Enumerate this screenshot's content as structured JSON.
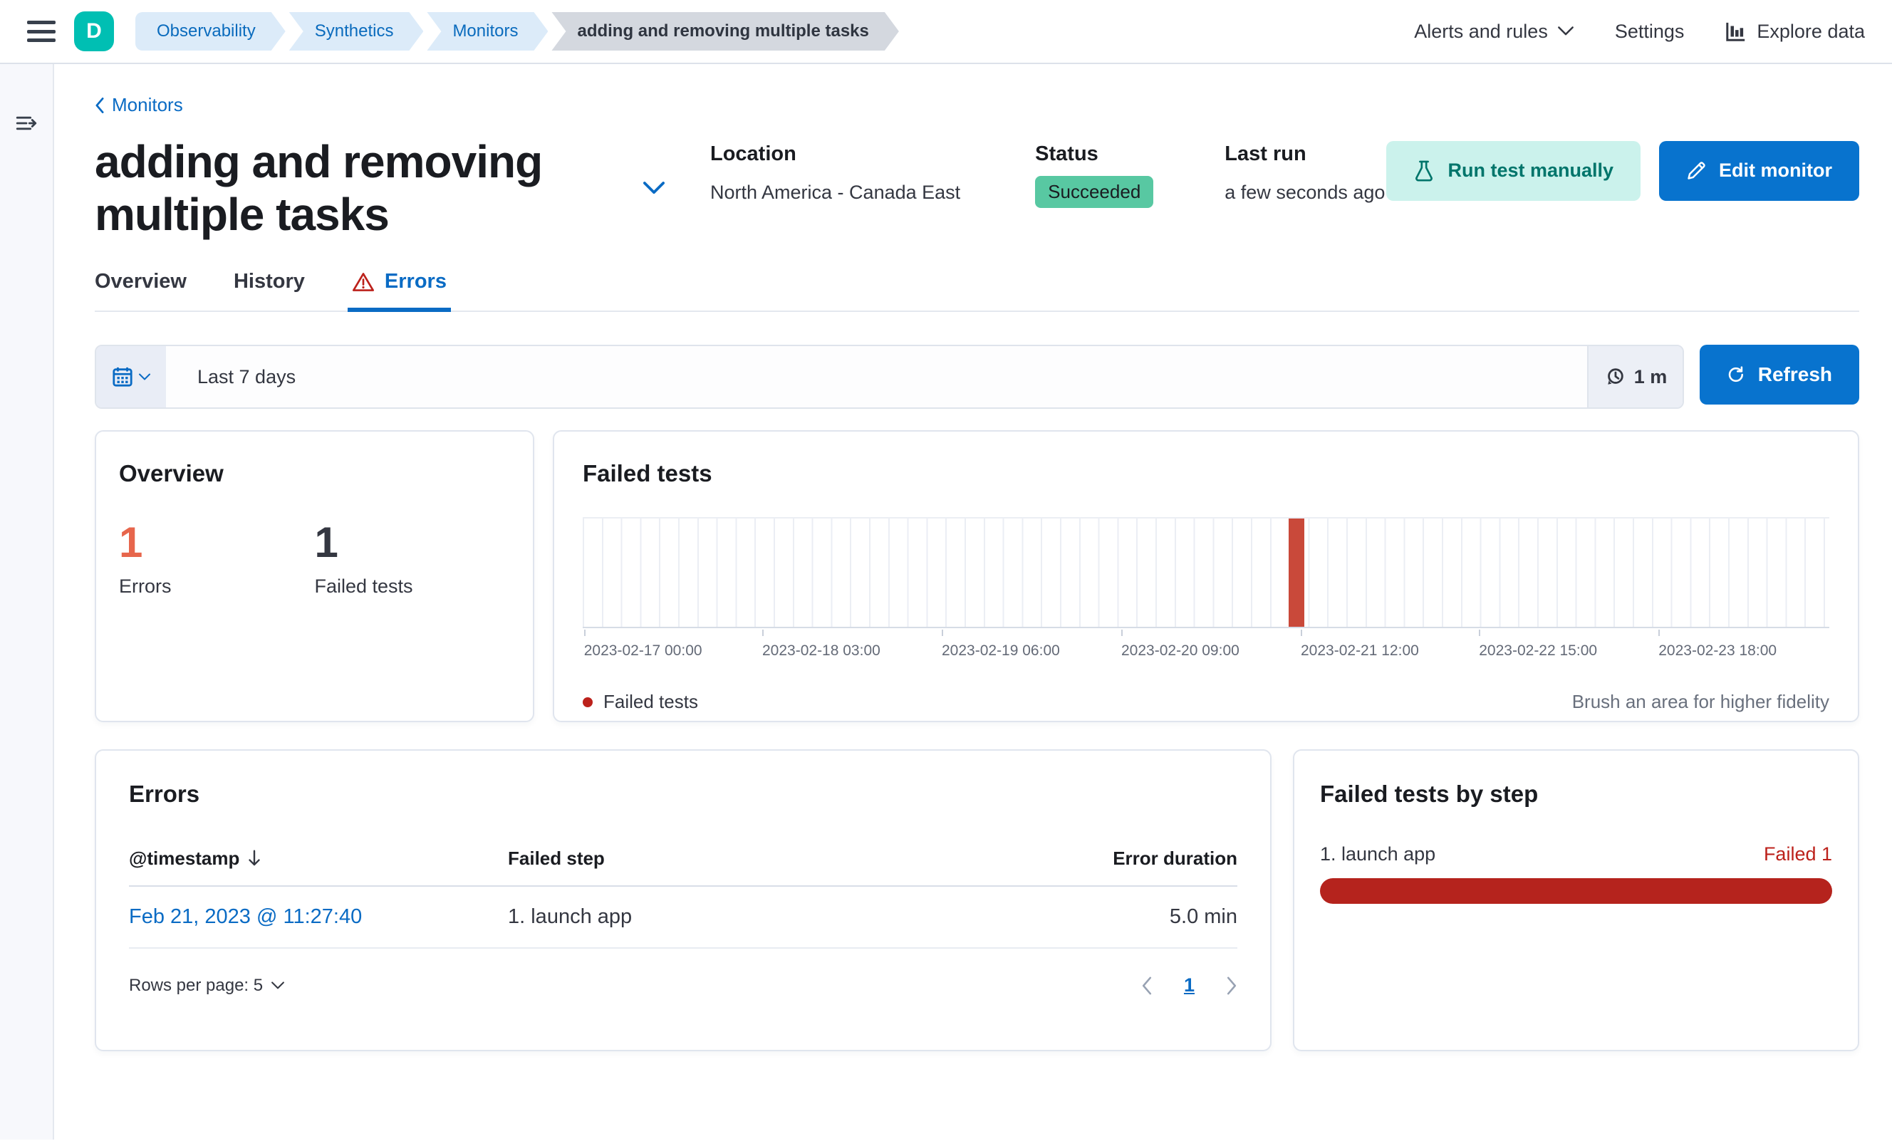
{
  "colors": {
    "primary_blue": "#0873CE",
    "link_blue": "#0A6BC4",
    "teal_badge": "#00BFB3",
    "success_green": "#58C8A2",
    "accent_orange": "#E7664C",
    "danger_red": "#BC211B",
    "bar_red": "#C9493A",
    "progress_red": "#B5231D"
  },
  "top_bar": {
    "deployment_initial": "D",
    "breadcrumbs": [
      "Observability",
      "Synthetics",
      "Monitors",
      "adding and removing multiple tasks"
    ],
    "alerts_menu_label": "Alerts and rules",
    "settings_label": "Settings",
    "explore_data_label": "Explore data"
  },
  "header": {
    "back_link": "Monitors",
    "title": "adding and removing multiple tasks",
    "location_label": "Location",
    "location_value": "North America - Canada East",
    "status_label": "Status",
    "status_value": "Succeeded",
    "last_run_label": "Last run",
    "last_run_value": "a few seconds ago",
    "run_test_button": "Run test manually",
    "edit_button": "Edit monitor"
  },
  "tabs": [
    {
      "label": "Overview"
    },
    {
      "label": "History"
    },
    {
      "label": "Errors"
    }
  ],
  "toolbar": {
    "time_range": "Last 7 days",
    "refresh_interval": "1 m",
    "refresh_button": "Refresh"
  },
  "overview_panel": {
    "title": "Overview",
    "stats": [
      {
        "value": "1",
        "label": "Errors",
        "color": "#E7664C"
      },
      {
        "value": "1",
        "label": "Failed tests",
        "color": "#343741"
      }
    ]
  },
  "chart_data": {
    "type": "bar",
    "title": "Failed tests",
    "series": [
      {
        "name": "Failed tests",
        "points": [
          {
            "x": "2023-02-21 11:27",
            "y": 1
          }
        ]
      }
    ],
    "x_range": [
      "2023-02-17 00:00",
      "2023-02-24 03:00"
    ],
    "ylim": [
      0,
      1
    ],
    "grid": true,
    "legend_position": "bottom",
    "x_tick_labels": [
      "2023-02-17 00:00",
      "2023-02-18 03:00",
      "2023-02-19 06:00",
      "2023-02-20 09:00",
      "2023-02-21 12:00",
      "2023-02-22 15:00",
      "2023-02-23 18:00"
    ],
    "x_tick_fractions": [
      0.001,
      0.144,
      0.288,
      0.432,
      0.576,
      0.719,
      0.863
    ],
    "bar": {
      "position_fraction": 0.566,
      "color": "#C9493A",
      "value": 1
    },
    "legend_label": "Failed tests",
    "annotation": "Brush an area for higher fidelity"
  },
  "errors_panel": {
    "title": "Errors",
    "columns": {
      "timestamp": "@timestamp",
      "failed_step": "Failed step",
      "error_duration": "Error duration"
    },
    "rows": [
      {
        "timestamp": "Feb 21, 2023 @ 11:27:40",
        "failed_step": "1. launch app",
        "error_duration": "5.0 min"
      }
    ],
    "rows_per_page_label": "Rows per page: 5",
    "page": "1"
  },
  "failed_by_step_panel": {
    "title": "Failed tests by step",
    "steps": [
      {
        "label": "1. launch app",
        "status": "Failed 1",
        "fraction": 1
      }
    ]
  }
}
